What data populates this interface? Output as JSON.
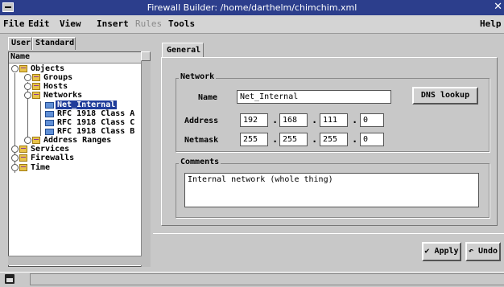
{
  "window": {
    "title": "Firewall Builder: /home/darthelm/chimchim.xml"
  },
  "menu": {
    "file": "File",
    "edit": "Edit",
    "view": "View",
    "insert": "Insert",
    "rules": "Rules",
    "tools": "Tools",
    "help": "Help"
  },
  "left": {
    "tabs": [
      "User",
      "Standard"
    ],
    "column_header": "Name",
    "tree": {
      "objects": "Objects",
      "groups": "Groups",
      "hosts": "Hosts",
      "networks": "Networks",
      "net_internal": "Net_Internal",
      "rfc_a": "RFC 1918 Class A",
      "rfc_c": "RFC 1918 Class C",
      "rfc_b": "RFC 1918 Class B",
      "address_ranges": "Address Ranges",
      "services": "Services",
      "firewalls": "Firewalls",
      "time": "Time"
    }
  },
  "right": {
    "tab": "General",
    "network_group": "Network",
    "name_label": "Name",
    "name_value": "Net_Internal",
    "dns_button": "DNS lookup",
    "address_label": "Address",
    "address": [
      "192",
      "168",
      "111",
      "0"
    ],
    "netmask_label": "Netmask",
    "netmask": [
      "255",
      "255",
      "255",
      "0"
    ],
    "dot": ".",
    "comments_group": "Comments",
    "comments_value": "Internal network (whole thing)",
    "apply_button": "Apply",
    "undo_button": "Undo"
  },
  "colors": {
    "titlebar": "#2c3e8c",
    "selection": "#1f3c9a",
    "folder": "#e8c34a",
    "network": "#5f8fd6"
  }
}
